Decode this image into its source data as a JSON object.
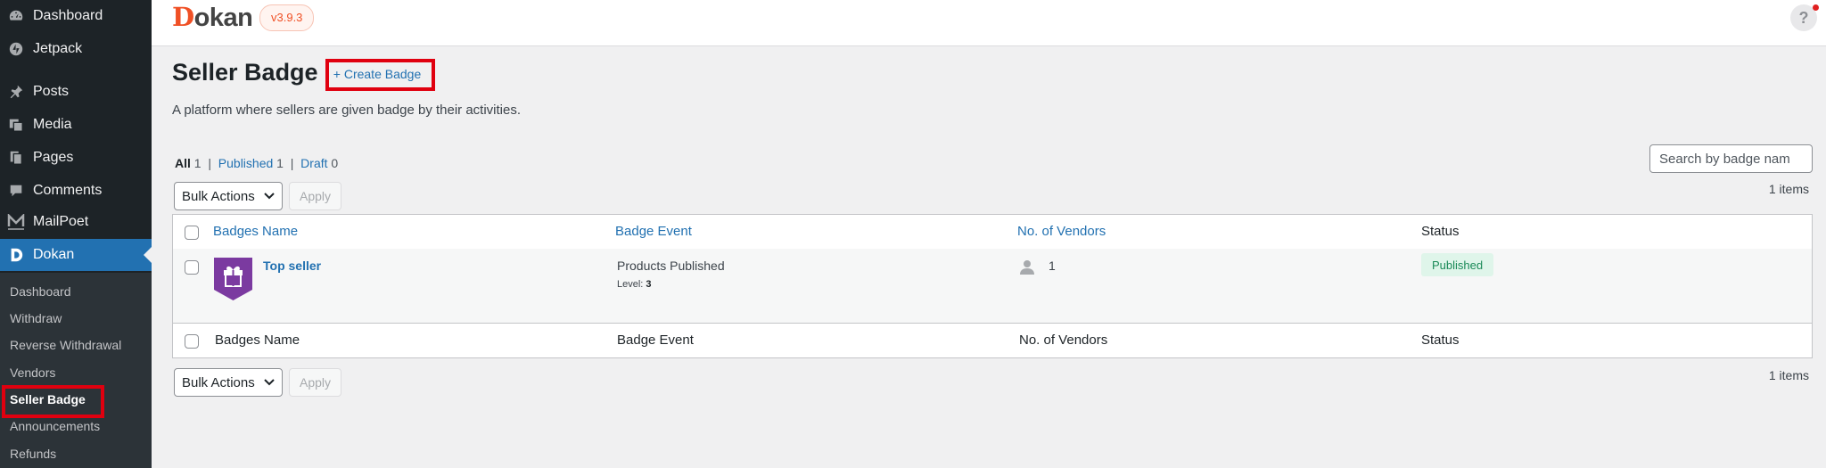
{
  "sidebar": {
    "menu": [
      {
        "label": "Dashboard",
        "icon": "dashboard-icon"
      },
      {
        "label": "Jetpack",
        "icon": "jetpack-icon"
      },
      {
        "label": "Posts",
        "icon": "pin-icon"
      },
      {
        "label": "Media",
        "icon": "media-icon"
      },
      {
        "label": "Pages",
        "icon": "pages-icon"
      },
      {
        "label": "Comments",
        "icon": "comment-icon"
      },
      {
        "label": "MailPoet",
        "icon": "mailpoet-icon"
      },
      {
        "label": "Dokan",
        "icon": "dokan-icon"
      }
    ],
    "submenu": [
      "Dashboard",
      "Withdraw",
      "Reverse Withdrawal",
      "Vendors",
      "Seller Badge",
      "Announcements",
      "Refunds"
    ]
  },
  "topbar": {
    "logo_initial": "D",
    "logo_rest": "okan",
    "version": "v3.9.3",
    "help_label": "?"
  },
  "page": {
    "title": "Seller Badge",
    "create_button": "+ Create Badge",
    "description": "A platform where sellers are given badge by their activities."
  },
  "filters": {
    "all_label": "All",
    "all_count": "1",
    "published_label": "Published",
    "published_count": "1",
    "draft_label": "Draft",
    "draft_count": "0",
    "separator": "|"
  },
  "search": {
    "placeholder": "Search by badge nam"
  },
  "bulk": {
    "label": "Bulk Actions",
    "apply": "Apply",
    "items": "1 items"
  },
  "table": {
    "columns": [
      "Badges Name",
      "Badge Event",
      "No. of Vendors",
      "Status"
    ],
    "rows": [
      {
        "name": "Top seller",
        "event": "Products Published",
        "level_label": "Level:",
        "level_value": "3",
        "vendors": "1",
        "status": "Published"
      }
    ]
  },
  "colors": {
    "accent": "#2271b1",
    "sidebar": "#1d2327",
    "badge": "#7b3aa0",
    "highlight": "#e0000f",
    "status_bg": "#dff5ea",
    "status_text": "#1a8a58"
  }
}
